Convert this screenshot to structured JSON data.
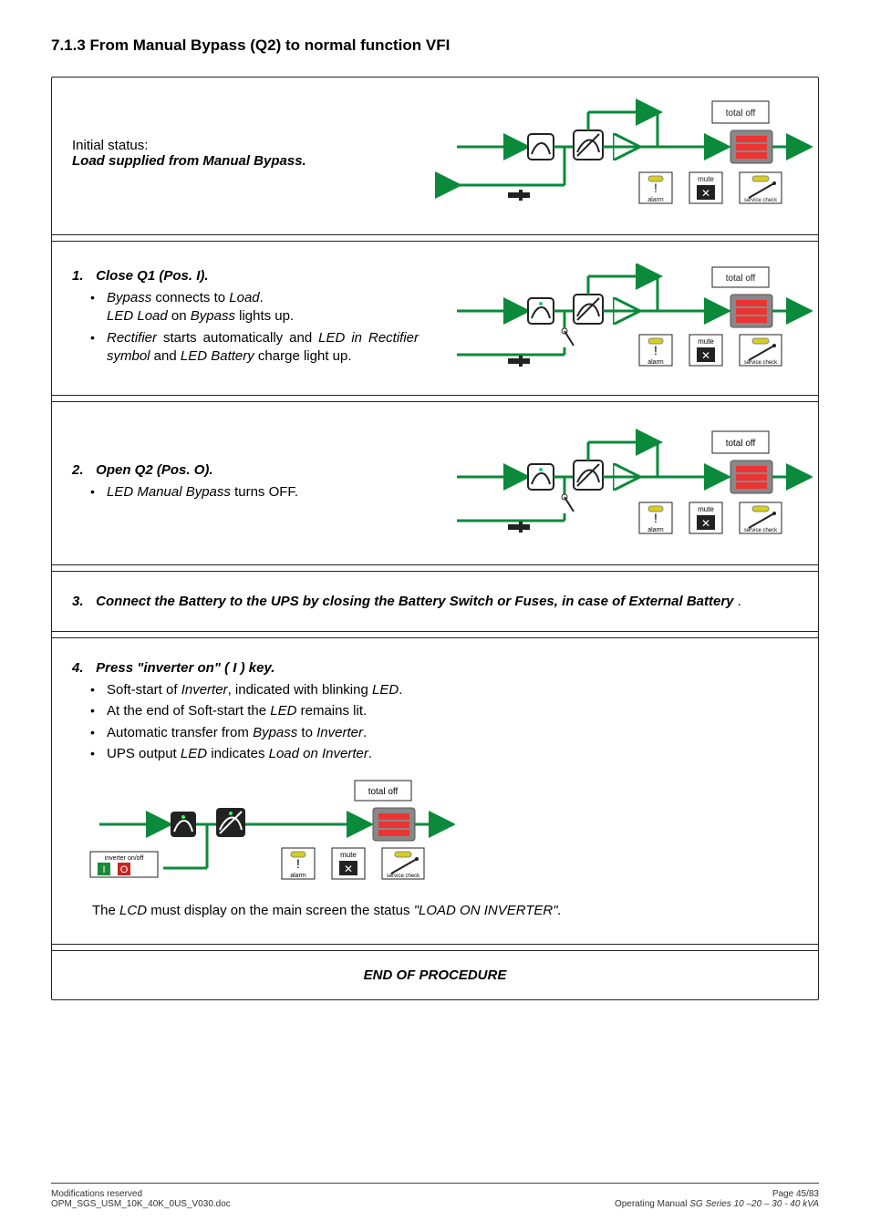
{
  "section_heading": "7.1.3   From Manual Bypass (Q2) to normal function VFI",
  "initial": {
    "line1": "Initial status:",
    "line2": "Load supplied from Manual Bypass."
  },
  "step1": {
    "num": "1.",
    "title": "Close Q1 (Pos. I).",
    "b1a": "Bypass",
    "b1b": " connects to ",
    "b1c": "Load",
    "b1d": ".",
    "b1e": "LED Load",
    "b1f": " on ",
    "b1g": "Bypass",
    "b1h": " lights up.",
    "b2a": "Rectifier",
    "b2b": " starts automatically and ",
    "b2c": "LED in Rectifier symbol",
    "b2d": " and ",
    "b2e": "LED Battery",
    "b2f": " charge light up."
  },
  "step2": {
    "num": "2.",
    "title": "Open Q2 (Pos. O).",
    "b1a": "LED Manual Bypass",
    "b1b": " turns OFF."
  },
  "step3": {
    "num": "3.",
    "text_a": "Connect the Battery to the UPS by closing the Battery Switch or Fuses, in case of External Battery",
    "text_b": " ."
  },
  "step4": {
    "num": "4.",
    "title": "Press \"inverter on\" ( I ) key.",
    "b1a": "Soft-start of ",
    "b1b": "Inverter",
    "b1c": ", indicated with blinking ",
    "b1d": "LED",
    "b1e": ".",
    "b2a": "At the end of Soft-start the ",
    "b2b": "LED",
    "b2c": " remains lit.",
    "b3a": "Automatic transfer from ",
    "b3b": "Bypass",
    "b3c": " to ",
    "b3d": "Inverter",
    "b3e": ".",
    "b4a": "UPS output ",
    "b4b": "LED",
    "b4c": " indicates ",
    "b4d": "Load on Inverter",
    "b4e": ".",
    "note_a": "The ",
    "note_b": "LCD",
    "note_c": " must display on the main screen the status ",
    "note_d": "\"LOAD ON INVERTER\"."
  },
  "end": "END OF PROCEDURE",
  "diagram_labels": {
    "total_off": "total off",
    "mute": "mute",
    "alarm": "alarm",
    "service_check": "service check",
    "inverter_onoff": "inverter on/off"
  },
  "footer": {
    "left1": "Modifications reserved",
    "left2": "OPM_SGS_USM_10K_40K_0US_V030.doc",
    "right1": "Page 45/83",
    "right2a": "Operating Manual ",
    "right2b": "SG Series 10 –20 – 30 - 40 kVA"
  }
}
